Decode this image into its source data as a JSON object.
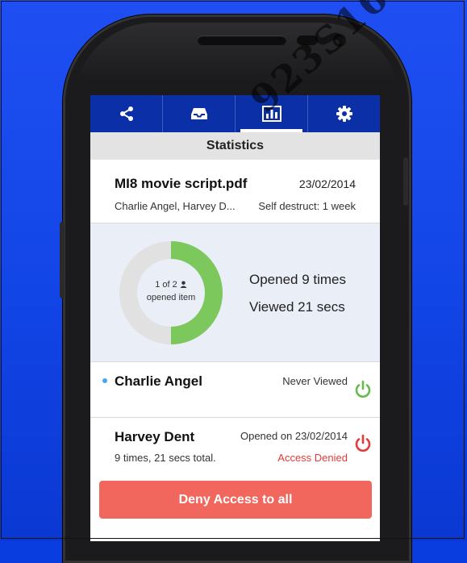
{
  "colors": {
    "background": "#1245e6",
    "topbar": "#0b2fa7",
    "donut_opened": "#7dc85c",
    "donut_rest": "#e1e1e1",
    "power_on": "#67bb4a",
    "power_denied": "#e33b3b",
    "deny_button": "#f1675d",
    "unread_dot": "#44a7ef"
  },
  "tabs": [
    {
      "icon": "share-icon",
      "active": false
    },
    {
      "icon": "inbox-icon",
      "active": false
    },
    {
      "icon": "statistics-icon",
      "active": true
    },
    {
      "icon": "gear-icon",
      "active": false
    }
  ],
  "screen_title": "Statistics",
  "file": {
    "name": "MI8 movie script.pdf",
    "date": "23/02/2014",
    "recipients": "Charlie Angel, Harvey D...",
    "self_destruct": "Self destruct: 1 week"
  },
  "stats": {
    "donut_line1": "1 of 2",
    "donut_line2": "opened item",
    "opened_fraction": 0.5,
    "opened": "Opened 9 times",
    "viewed": "Viewed 21 secs"
  },
  "recipients": [
    {
      "name": "Charlie Angel",
      "status": "Never Viewed",
      "icon": "power-icon"
    },
    {
      "name": "Harvey Dent",
      "opened": "Opened on 23/02/2014",
      "total": "9 times, 21 secs total.",
      "access": "Access Denied",
      "icon": "power-icon"
    }
  ],
  "deny_button": "Deny Access to all",
  "watermark": "923S16"
}
